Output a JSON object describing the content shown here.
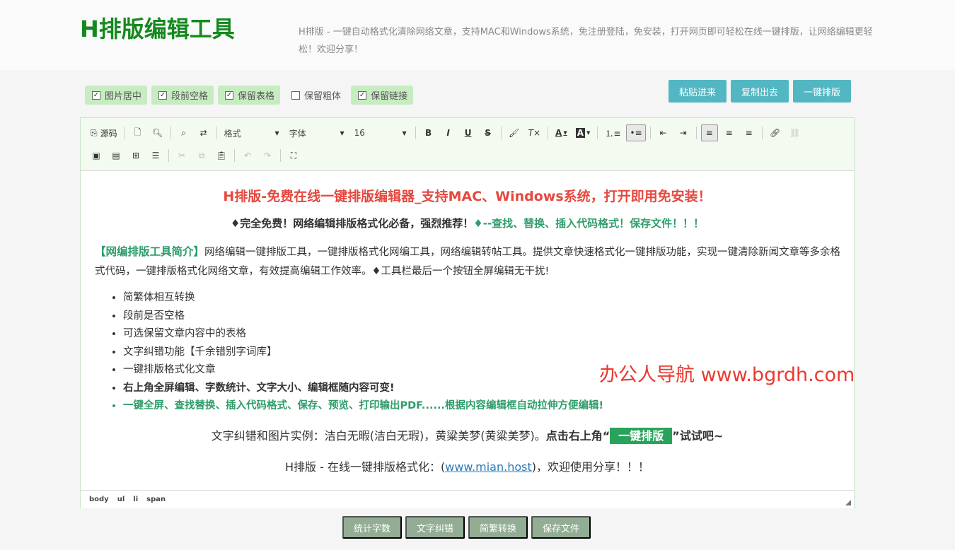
{
  "header": {
    "logo": "H排版编辑工具",
    "tagline": "H排版 - 一键自动格式化清除网络文章，支持MAC和Windows系统，免注册登陆，免安装，打开网页即可轻松在线一键排版，让网络编辑更轻松！欢迎分享！"
  },
  "options": [
    {
      "label": "图片居中",
      "checked": true
    },
    {
      "label": "段前空格",
      "checked": true
    },
    {
      "label": "保留表格",
      "checked": true
    },
    {
      "label": "保留粗体",
      "checked": false
    },
    {
      "label": "保留链接",
      "checked": true
    }
  ],
  "actions": {
    "paste": "粘贴进来",
    "copy": "复制出去",
    "format": "一键排版"
  },
  "toolbar": {
    "source": "源码",
    "format_combo": "格式",
    "font_combo": "字体",
    "size_combo": "16",
    "icons": {
      "bold": "B",
      "italic": "I",
      "underline": "U",
      "strike": "S",
      "font_color": "A",
      "bg_color": "A"
    }
  },
  "content": {
    "title": "H排版-免费在线一键排版编辑器_支持MAC、Windows系统，打开即用免安装！",
    "subtitle_main": "♦完全免费！网络编辑排版格式化必备，强烈推荐！",
    "subtitle_green": "♦--查找、替换、插入代码格式！保存文件！！！",
    "intro_title": "【网编排版工具简介】",
    "intro_text": "网络编辑一键排版工具，一键排版格式化网编工具，网络编辑转帖工具。提供文章快速格式化一键排版功能，实现一键清除新闻文章等多余格式代码，一键排版格式化网络文章，有效提高编辑工作效率。♦工具栏最后一个按钮全屏编辑无干扰!",
    "features": [
      "简繁体相互转换",
      "段前是否空格",
      "可选保留文章内容中的表格",
      "文字纠错功能【千余错别字词库】",
      "一键排版格式化文章",
      "右上角全屏编辑、字数统计、文字大小、编辑框随内容可变!",
      "一键全屏、查找替换、插入代码格式、保存、预览、打印输出PDF......根据内容编辑框自动拉伸方便编辑!"
    ],
    "example_text": "文字纠错和图片实例：洁白无暇(洁白无瑕)，黄粱美梦(黄粱美梦)。",
    "example_bold_a": "点击右上角“",
    "example_tag": "一键排版",
    "example_bold_b": "”试试吧~",
    "footer_prefix": "H排版 - 在线一键排版格式化：(",
    "footer_link": "www.mian.host",
    "footer_suffix": ")，欢迎使用分享！！！"
  },
  "watermark": "办公人导航 www.bgrdh.com",
  "statusbar": [
    "body",
    "ul",
    "li",
    "span"
  ],
  "bottom_buttons": [
    "统计字数",
    "文字纠错",
    "简繁转换",
    "保存文件"
  ]
}
